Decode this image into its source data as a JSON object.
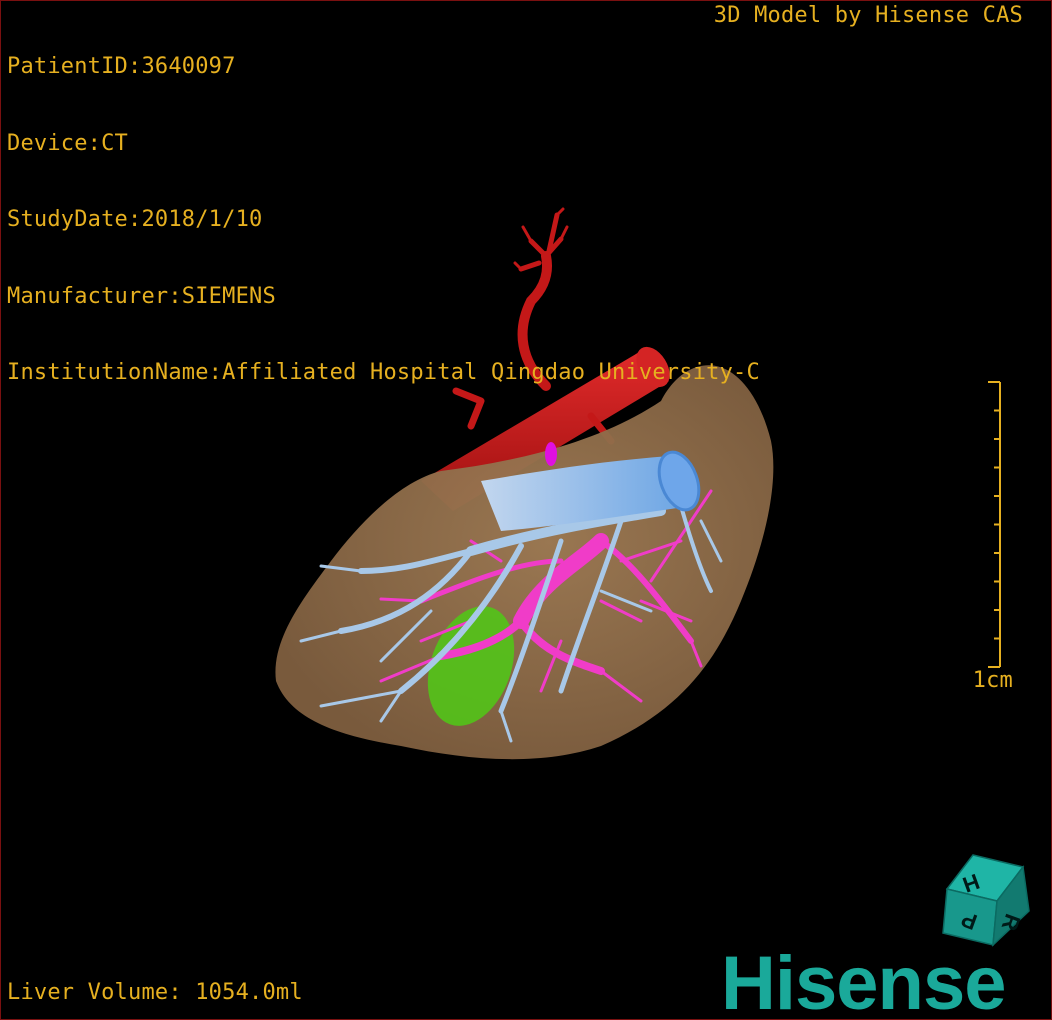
{
  "info": {
    "patient_id": "PatientID:3640097",
    "device": "Device:CT",
    "study_date": "StudyDate:2018/1/10",
    "manufacturer": "Manufacturer:SIEMENS",
    "institution": "InstitutionName:Affiliated Hospital Qingdao University-C"
  },
  "title": "3D Model by Hisense CAS",
  "volume": "Liver Volume: 1054.0ml",
  "scale": {
    "label": "1cm",
    "ticks": 11
  },
  "orientation_cube": {
    "top": "H",
    "left": "P",
    "right": "R"
  },
  "brand": {
    "logo": "Hisense"
  },
  "colors": {
    "text": "#e6b020",
    "liver": "#94704c",
    "artery": "#c41818",
    "portal_vein": "#f03cc8",
    "hepatic_vein": "#a8c8e8",
    "gallbladder": "#52c418",
    "brand": "#1aa99a",
    "background": "#000000"
  }
}
